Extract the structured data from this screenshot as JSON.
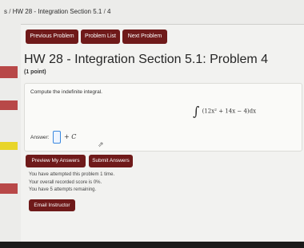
{
  "breadcrumb": {
    "lead": "s",
    "sep1": "/",
    "set": "HW 28 - Integration Section 5.1",
    "sep2": "/",
    "problem": "4"
  },
  "nav": {
    "previous_label": "Previous Problem",
    "list_label": "Problem List",
    "next_label": "Next Problem"
  },
  "header": {
    "title": "HW 28 - Integration Section 5.1: Problem 4",
    "points": "(1 point)"
  },
  "problem": {
    "prompt": "Compute the indefinite integral.",
    "integral_symbol": "∫",
    "integrand": "(12x² + 14x − 4)dx",
    "answer_label": "Answer:",
    "answer_value": "",
    "constant": "+ C"
  },
  "actions": {
    "preview_label": "Preview My Answers",
    "submit_label": "Submit Answers"
  },
  "status": {
    "attempted": "You have attempted this problem 1 time.",
    "score": "Your overall recorded score is 0%.",
    "remaining": "You have 5 attempts remaining."
  },
  "footer": {
    "email_label": "Email Instructor"
  },
  "colors": {
    "button_bg": "#6f1a1a",
    "input_focus": "#3a88e0",
    "sidebar_mark": "#b84848",
    "sidebar_highlight": "#e8d52a"
  }
}
